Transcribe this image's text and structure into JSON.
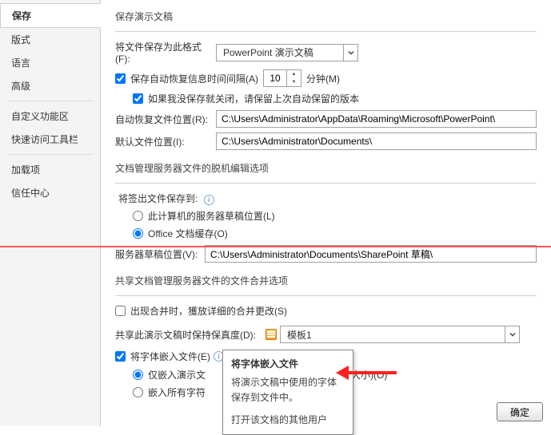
{
  "sidebar": {
    "items": [
      {
        "label": "保存"
      },
      {
        "label": "版式"
      },
      {
        "label": "语言"
      },
      {
        "label": "高级"
      },
      {
        "label": "自定义功能区"
      },
      {
        "label": "快速访问工具栏"
      },
      {
        "label": "加载项"
      },
      {
        "label": "信任中心"
      }
    ]
  },
  "sections": {
    "save_pres": "保存演示文稿",
    "doc_mgmt": "文档管理服务器文件的脱机编辑选项",
    "merge": "共享文档管理服务器文件的文件合并选项",
    "checkout_to": "将签出文件保存到:"
  },
  "labels": {
    "save_format": "将文件保存为此格式(F):",
    "autorecover_path": "自动恢复文件位置(R):",
    "default_path": "默认文件位置(I):",
    "server_draft_path": "服务器草稿位置(V):",
    "fidelity": "共享此演示文稿时保持保真度(D):",
    "minutes": "分钟(M)"
  },
  "values": {
    "format": "PowerPoint 演示文稿",
    "interval": "10",
    "autorecover_path": "C:\\Users\\Administrator\\AppData\\Roaming\\Microsoft\\PowerPoint\\",
    "default_path": "C:\\Users\\Administrator\\Documents\\",
    "server_draft_path": "C:\\Users\\Administrator\\Documents\\SharePoint 草稿\\",
    "fidelity_doc": "模板1"
  },
  "checkboxes": {
    "autosave": "保存自动恢复信息时间间隔(A)",
    "keep_last": "如果我没保存就关闭，请保留上次自动保留的版本",
    "show_merge": "出现合并时，獲放详细的合并更改(S)",
    "embed_fonts": "将字体嵌入文件(E)"
  },
  "radios": {
    "local_drafts": "此计算机的服务器草稿位置(L)",
    "office_cache": "Office 文档缓存(O)",
    "embed_used": "仅嵌入演示文",
    "embed_used_tail": "件大小)(O)",
    "embed_all": "嵌入所有字符"
  },
  "tooltip": {
    "title": "将字体嵌入文件",
    "line1": "将演示文稿中使用的字体保存到文件中。",
    "line2": "打开该文档的其他用户"
  },
  "buttons": {
    "ok": "确定"
  }
}
